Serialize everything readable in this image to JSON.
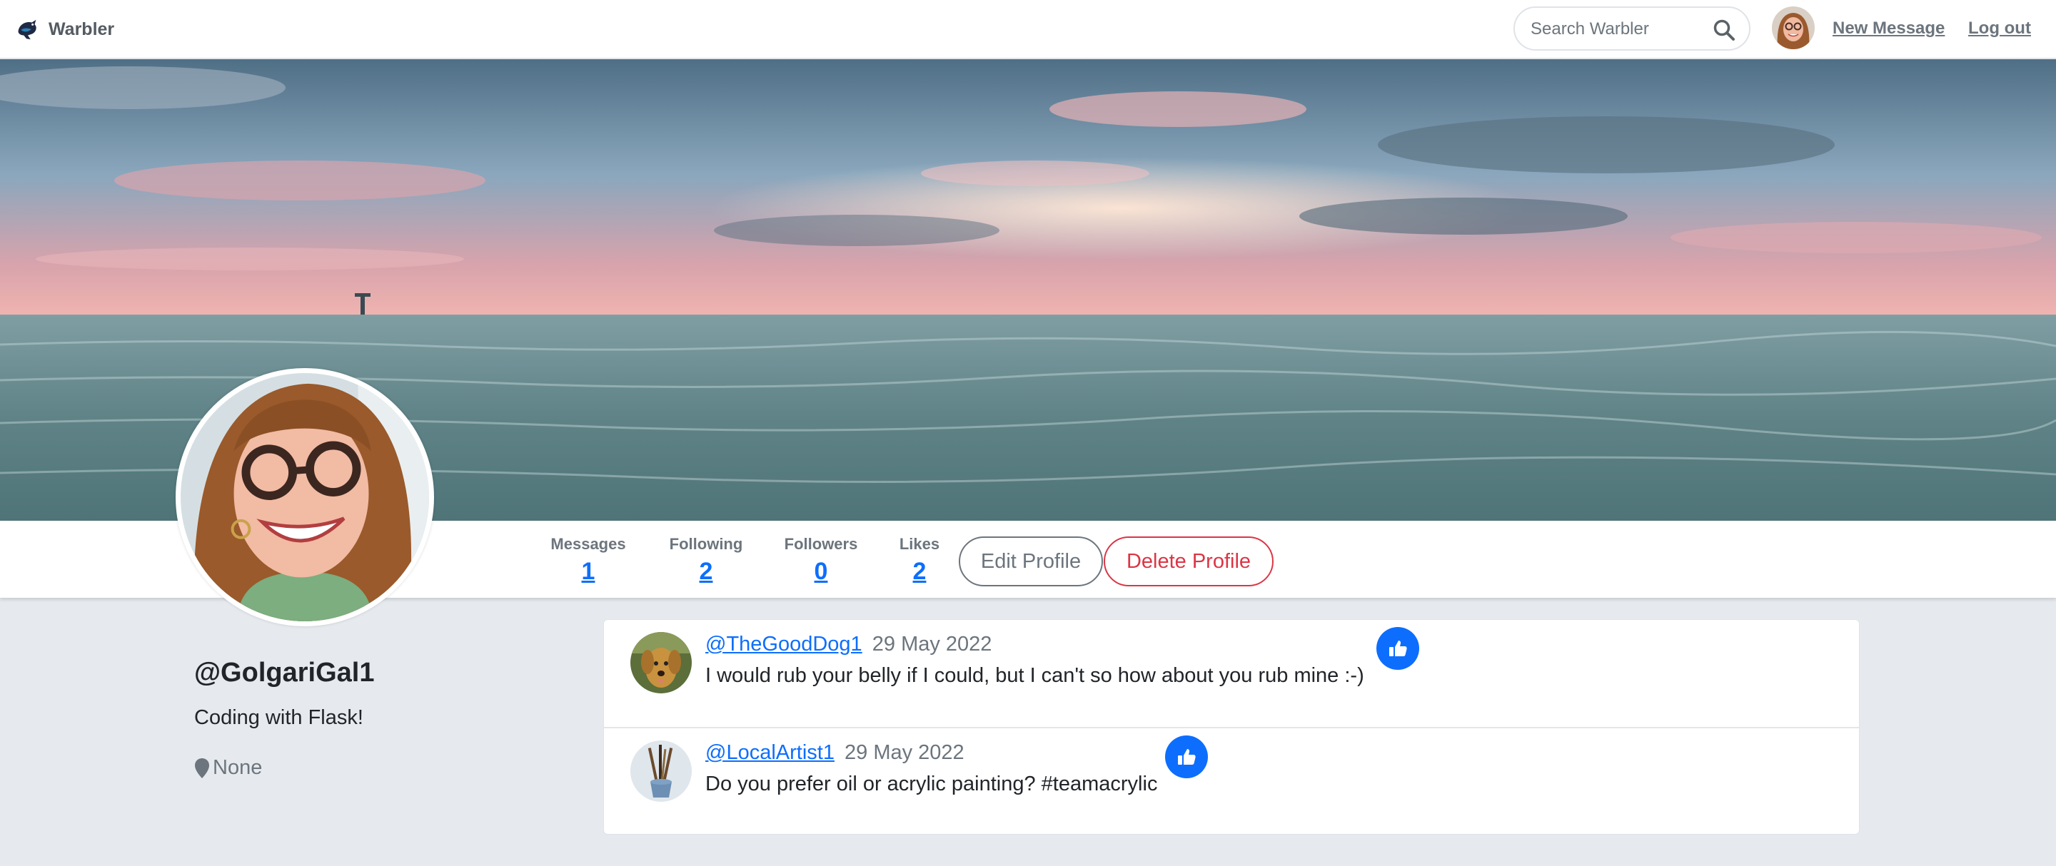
{
  "navbar": {
    "brand": "Warbler",
    "search_placeholder": "Search Warbler",
    "new_message": "New Message",
    "logout": "Log out"
  },
  "profile": {
    "username": "@GolgariGal1",
    "bio": "Coding with Flask!",
    "location": "None"
  },
  "stats": {
    "messages_label": "Messages",
    "messages_value": "1",
    "following_label": "Following",
    "following_value": "2",
    "followers_label": "Followers",
    "followers_value": "0",
    "likes_label": "Likes",
    "likes_value": "2"
  },
  "actions": {
    "edit": "Edit Profile",
    "delete": "Delete Profile"
  },
  "messages": [
    {
      "user": "@TheGoodDog1",
      "date": "29 May 2022",
      "text": "I would rub your belly if I could, but I can't so how about you rub mine :-)"
    },
    {
      "user": "@LocalArtist1",
      "date": "29 May 2022",
      "text": "Do you prefer oil or acrylic painting? #teamacrylic"
    }
  ],
  "colors": {
    "link": "#0d6efd",
    "danger": "#dc3545",
    "muted": "#6c757d",
    "page_bg": "#e6eaee"
  }
}
